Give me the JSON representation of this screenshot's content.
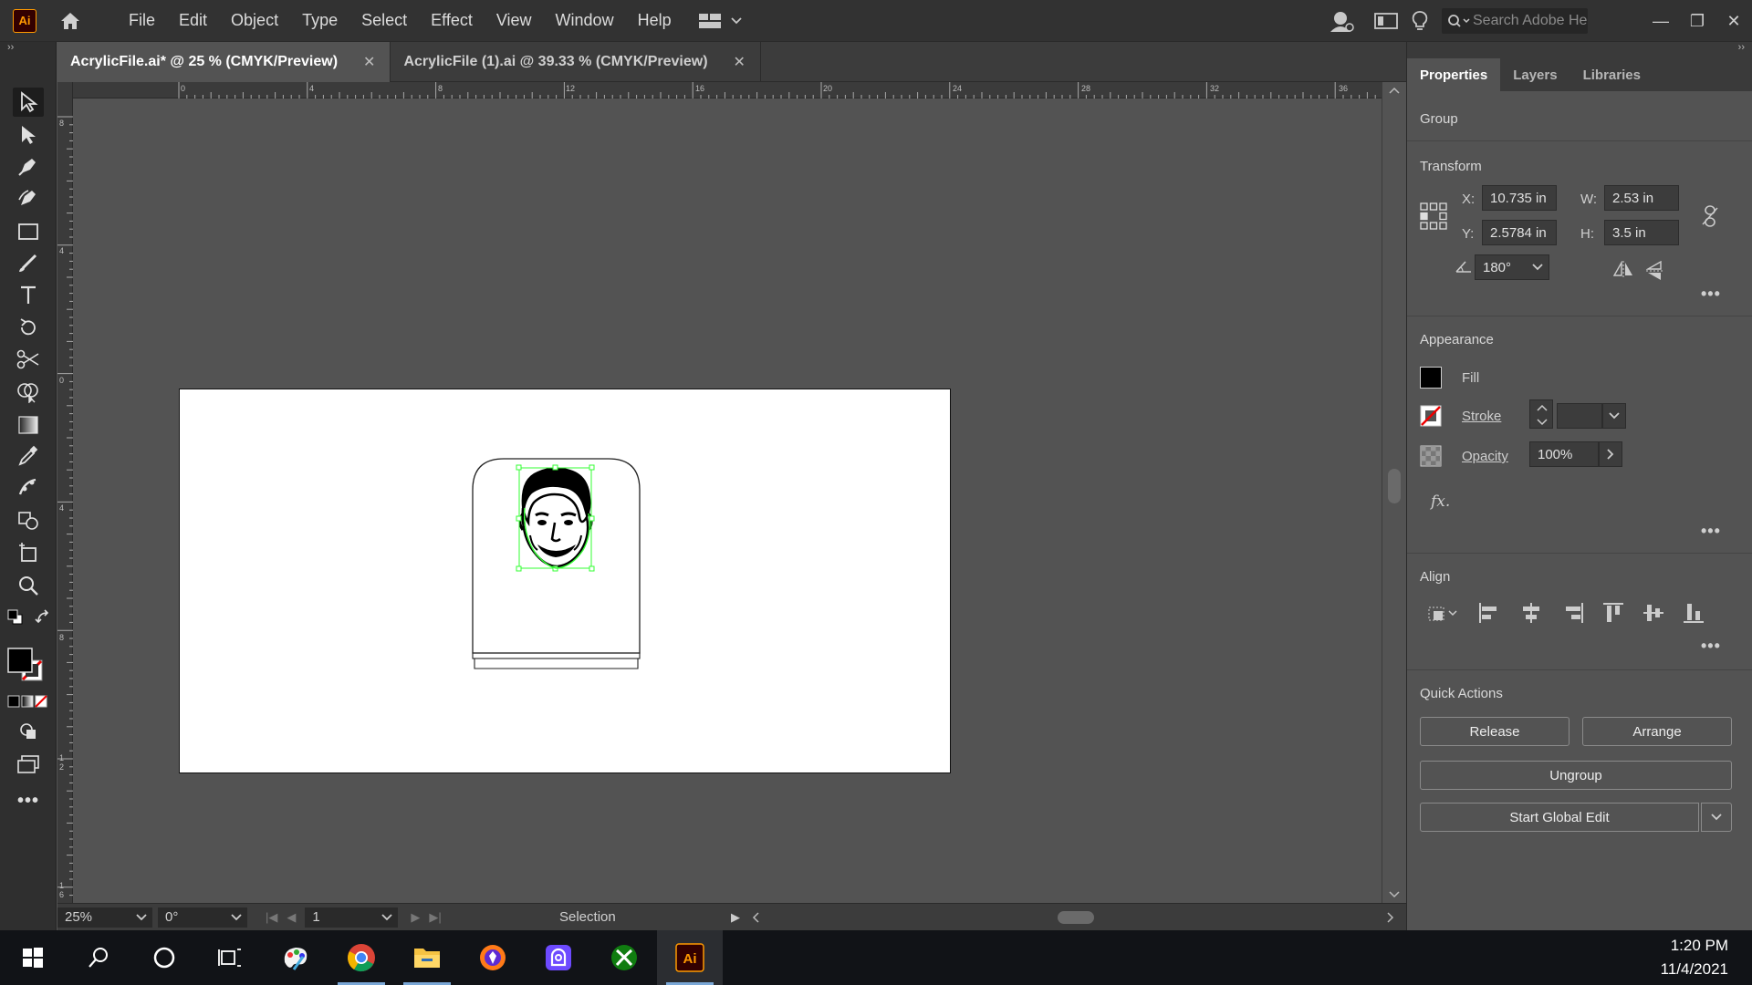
{
  "menubar": {
    "app_logo": "Ai",
    "menus": [
      "File",
      "Edit",
      "Object",
      "Type",
      "Select",
      "Effect",
      "View",
      "Window",
      "Help"
    ],
    "search_placeholder": "Search Adobe He",
    "window_controls": [
      "—",
      "❐",
      "✕"
    ]
  },
  "tabs": [
    {
      "label": "AcrylicFile.ai* @ 25 % (CMYK/Preview)",
      "close": "✕",
      "active": true
    },
    {
      "label": "AcrylicFile (1).ai @ 39.33 % (CMYK/Preview)",
      "close": "✕",
      "active": false
    }
  ],
  "ruler": {
    "top_labels": [
      "0",
      "4",
      "8",
      "12",
      "16",
      "20",
      "24",
      "28",
      "32",
      "36"
    ],
    "left_labels": [
      "8",
      "4",
      "0",
      "4",
      "8",
      "1\n2",
      "1\n6"
    ]
  },
  "statusbar": {
    "zoom": "25%",
    "rotation": "0°",
    "artboard_number": "1",
    "tool_name": "Selection"
  },
  "properties": {
    "tabs": [
      "Properties",
      "Layers",
      "Libraries"
    ],
    "selection_type": "Group",
    "transform": {
      "title": "Transform",
      "x_label": "X:",
      "x": "10.735 in",
      "y_label": "Y:",
      "y": "2.5784 in",
      "w_label": "W:",
      "w": "2.53 in",
      "h_label": "H:",
      "h": "3.5 in",
      "angle": "180°"
    },
    "appearance": {
      "title": "Appearance",
      "fill_label": "Fill",
      "stroke_label": "Stroke",
      "opacity_label": "Opacity",
      "opacity": "100%",
      "fx_label": "fx."
    },
    "align": {
      "title": "Align"
    },
    "quick_actions": {
      "title": "Quick Actions",
      "release": "Release",
      "arrange": "Arrange",
      "ungroup": "Ungroup",
      "start_global_edit": "Start Global Edit"
    },
    "more": "•••"
  },
  "taskbar": {
    "time": "1:20 PM",
    "date": "11/4/2021"
  },
  "colors": {
    "selection": "#33ff33",
    "ai_orange": "#ff9a00",
    "ui_dark": "#323232"
  }
}
